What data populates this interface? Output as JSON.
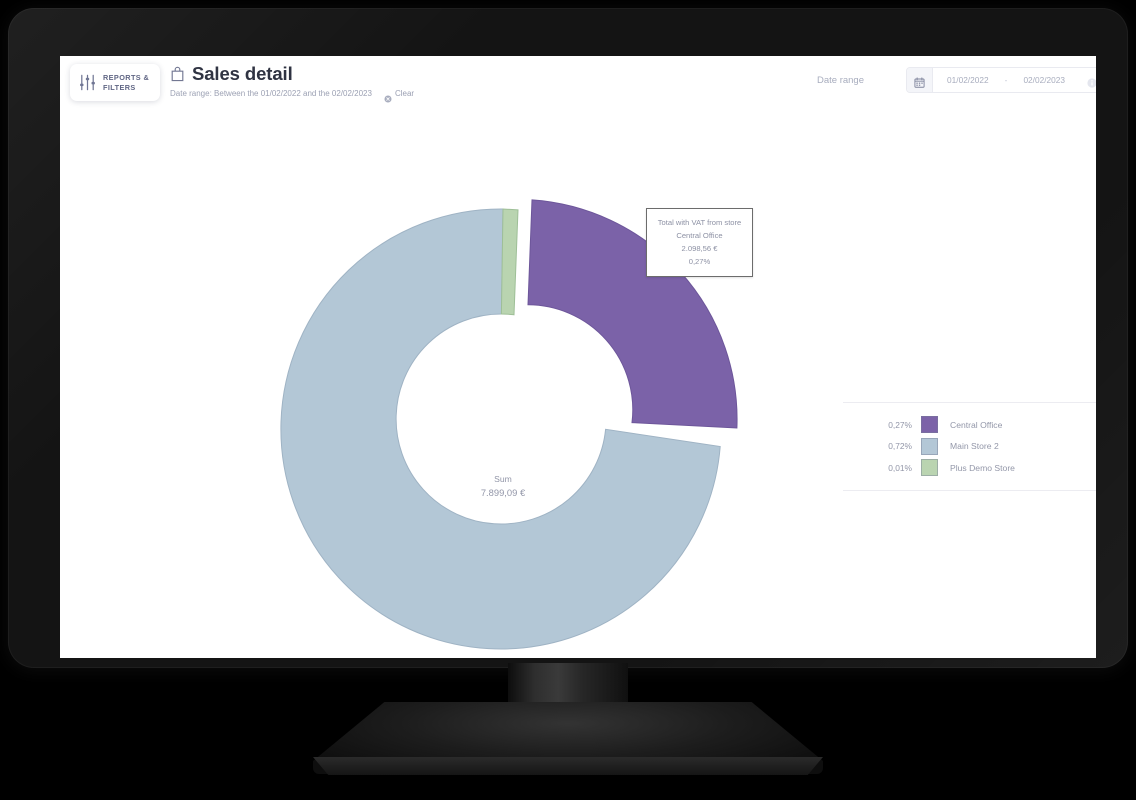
{
  "app": {
    "reports_filters": {
      "line1": "REPORTS &",
      "line2": "FILTERS",
      "icon": "sliders-icon"
    },
    "title": "Sales detail",
    "title_icon": "shopping-bag-icon",
    "subtitle": "Date range: Between the 01/02/2022 and the 02/02/2023",
    "clear_label": "Clear",
    "clear_icon": "clear-circle-icon",
    "date_range": {
      "label": "Date range",
      "calendar_icon": "calendar-icon",
      "start": "01/02/2022",
      "separator": "-",
      "end": "02/02/2023",
      "info_icon": "info-icon"
    }
  },
  "center": {
    "title": "Sum",
    "value": "7.899,09 €"
  },
  "tooltip": {
    "line1": "Total with VAT from store",
    "line2": "Central Office",
    "line3": "2.098,56 €",
    "line4": "0,27%"
  },
  "legend": {
    "rows": [
      {
        "pct": "0,27%",
        "name": "Central Office",
        "color": "#7B62A8"
      },
      {
        "pct": "0,72%",
        "name": "Main Store 2",
        "color": "#B3C7D6"
      },
      {
        "pct": "0,01%",
        "name": "Plus Demo Store",
        "color": "#B9D4B0"
      }
    ]
  },
  "chart_data": {
    "type": "pie",
    "title": "Sales detail",
    "subtitle": "Total with VAT from store",
    "variant": "donut",
    "center_text": [
      "Sum",
      "7.899,09 €"
    ],
    "currency": "EUR",
    "total": "7.899,09 €",
    "labels": [
      "Central Office",
      "Main Store 2",
      "Plus Demo Store"
    ],
    "percent_labels": [
      "0,27%",
      "0,72%",
      "0,01%"
    ],
    "values": [
      27.0,
      72.0,
      1.0
    ],
    "value_amounts": [
      "2.098,56 €",
      null,
      null
    ],
    "colors": [
      "#7B62A8",
      "#B3C7D6",
      "#B9D4B0"
    ],
    "exploded_slice": "Central Office",
    "start_angle_deg": 0,
    "legend_position": "right",
    "grid": false
  }
}
